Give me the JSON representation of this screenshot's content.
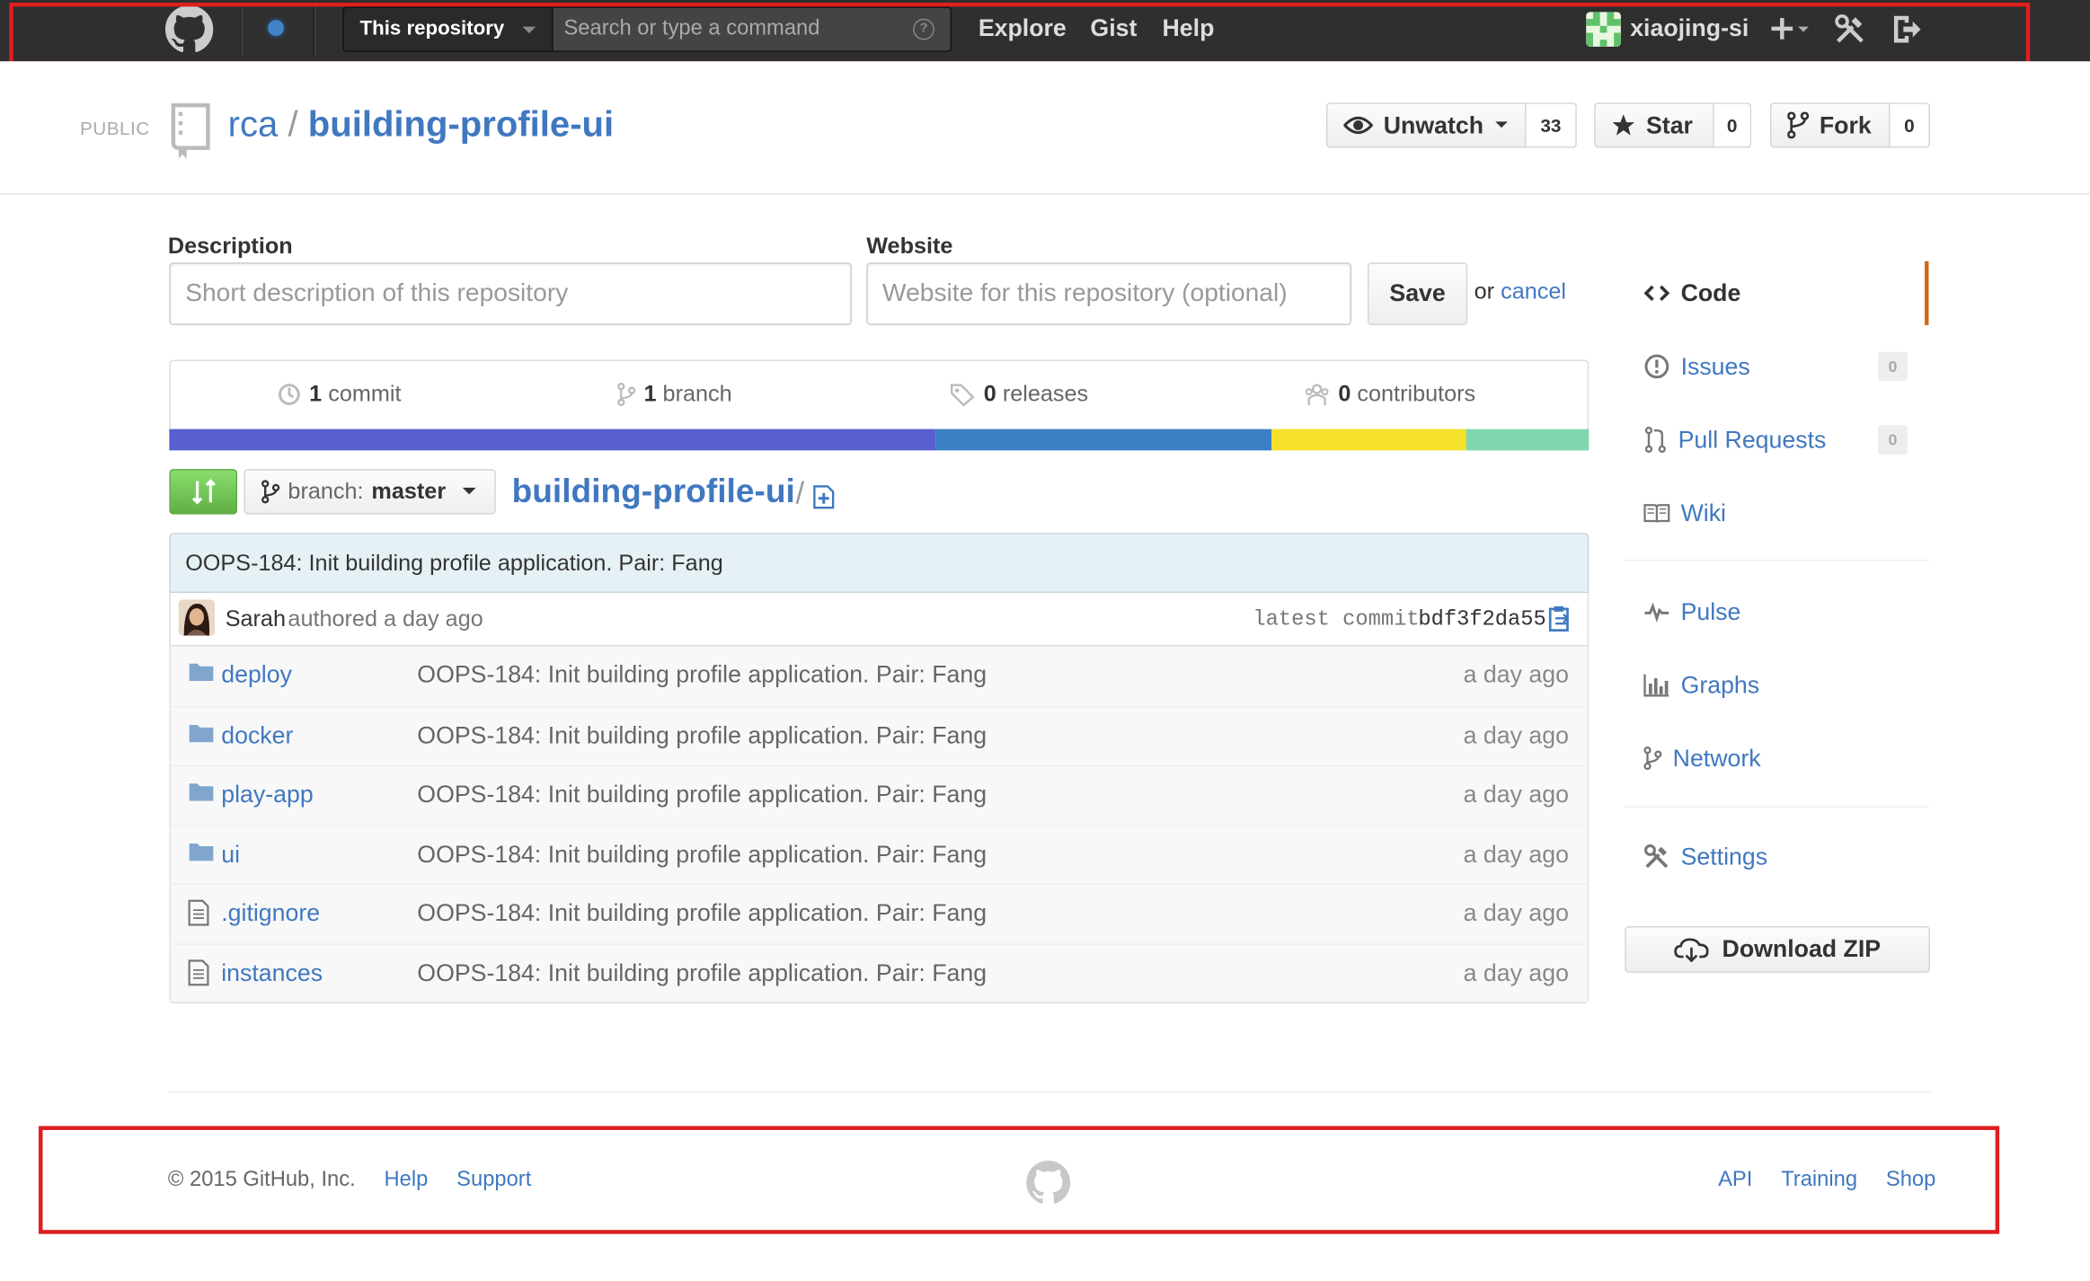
{
  "header": {
    "scope_label": "This repository",
    "search_placeholder": "Search or type a command",
    "nav": [
      "Explore",
      "Gist",
      "Help"
    ],
    "username": "xiaojing-si",
    "add_icon": "plus-icon",
    "settings_icon": "tools-icon",
    "signout_icon": "sign-out-icon"
  },
  "repo": {
    "visibility": "PUBLIC",
    "owner": "rca",
    "separator": "/",
    "name": "building-profile-ui",
    "watch_label": "Unwatch",
    "watch_count": "33",
    "star_label": "Star",
    "star_count": "0",
    "fork_label": "Fork",
    "fork_count": "0"
  },
  "edit": {
    "description_label": "Description",
    "description_placeholder": "Short description of this repository",
    "website_label": "Website",
    "website_placeholder": "Website for this repository (optional)",
    "save_label": "Save",
    "or_text": "or",
    "cancel_label": "cancel"
  },
  "summary": {
    "commits_num": "1",
    "commits_label": "commit",
    "branches_num": "1",
    "branches_label": "branch",
    "releases_num": "0",
    "releases_label": "releases",
    "contributors_num": "0",
    "contributors_label": "contributors",
    "language_colors": [
      "#5a5fd0",
      "#3b7fc4",
      "#f5e12a",
      "#7fd6b0"
    ],
    "language_fractions": [
      0.54,
      0.237,
      0.137,
      0.086
    ]
  },
  "file_nav": {
    "branch_prefix": "branch:",
    "branch_name": "master",
    "breadcrumb_root": "building-profile-ui",
    "breadcrumb_sep": "/"
  },
  "commit": {
    "message": "OOPS-184: Init building profile application. Pair: Fang",
    "author": "Sarah",
    "authored_text": "authored a day ago",
    "latest_label": "latest commit",
    "sha": "bdf3f2da55"
  },
  "files": [
    {
      "type": "folder",
      "name": "deploy",
      "message": "OOPS-184: Init building profile application. Pair: Fang",
      "age": "a day ago"
    },
    {
      "type": "folder",
      "name": "docker",
      "message": "OOPS-184: Init building profile application. Pair: Fang",
      "age": "a day ago"
    },
    {
      "type": "folder",
      "name": "play-app",
      "message": "OOPS-184: Init building profile application. Pair: Fang",
      "age": "a day ago"
    },
    {
      "type": "folder",
      "name": "ui",
      "message": "OOPS-184: Init building profile application. Pair: Fang",
      "age": "a day ago"
    },
    {
      "type": "file",
      "name": ".gitignore",
      "message": "OOPS-184: Init building profile application. Pair: Fang",
      "age": "a day ago"
    },
    {
      "type": "file",
      "name": "instances",
      "message": "OOPS-184: Init building profile application. Pair: Fang",
      "age": "a day ago"
    }
  ],
  "sidebar": {
    "code": "Code",
    "issues": "Issues",
    "issues_count": "0",
    "pulls": "Pull Requests",
    "pulls_count": "0",
    "wiki": "Wiki",
    "pulse": "Pulse",
    "graphs": "Graphs",
    "network": "Network",
    "settings": "Settings",
    "download": "Download ZIP",
    "active_color": "#d26911"
  },
  "footer": {
    "copyright": "© 2015 GitHub, Inc.",
    "left_links": [
      "Help",
      "Support"
    ],
    "right_links": [
      "API",
      "Training",
      "Shop"
    ]
  },
  "annotations": {
    "highlight_color": "#e01e1e"
  }
}
